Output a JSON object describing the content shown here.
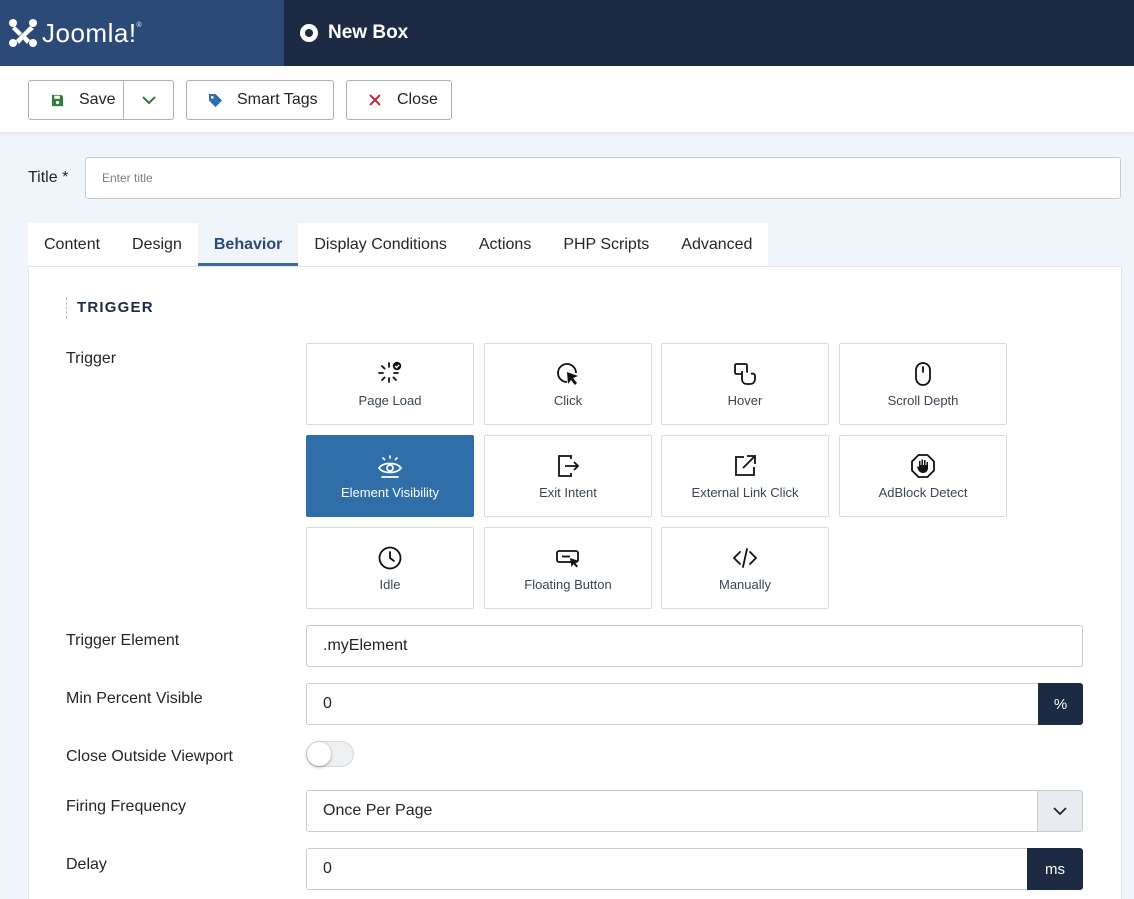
{
  "header": {
    "logo_text": "Joomla!",
    "page_title": "New Box"
  },
  "toolbar": {
    "save_label": "Save",
    "smart_tags_label": "Smart Tags",
    "close_label": "Close"
  },
  "form": {
    "title_label": "Title *",
    "title_placeholder": "Enter title",
    "title_value": ""
  },
  "tabs": [
    {
      "label": "Content",
      "active": false
    },
    {
      "label": "Design",
      "active": false
    },
    {
      "label": "Behavior",
      "active": true
    },
    {
      "label": "Display Conditions",
      "active": false
    },
    {
      "label": "Actions",
      "active": false
    },
    {
      "label": "PHP Scripts",
      "active": false
    },
    {
      "label": "Advanced",
      "active": false
    }
  ],
  "behavior": {
    "section_heading": "TRIGGER",
    "trigger_label": "Trigger",
    "triggers": [
      {
        "label": "Page Load",
        "icon": "page-load-icon",
        "selected": false
      },
      {
        "label": "Click",
        "icon": "click-icon",
        "selected": false
      },
      {
        "label": "Hover",
        "icon": "hover-icon",
        "selected": false
      },
      {
        "label": "Scroll Depth",
        "icon": "mouse-icon",
        "selected": false
      },
      {
        "label": "Element Visibility",
        "icon": "eye-icon",
        "selected": true
      },
      {
        "label": "Exit Intent",
        "icon": "exit-icon",
        "selected": false
      },
      {
        "label": "External Link Click",
        "icon": "external-link-icon",
        "selected": false
      },
      {
        "label": "AdBlock Detect",
        "icon": "adblock-icon",
        "selected": false
      },
      {
        "label": "Idle",
        "icon": "clock-icon",
        "selected": false
      },
      {
        "label": "Floating Button",
        "icon": "floating-button-icon",
        "selected": false
      },
      {
        "label": "Manually",
        "icon": "code-icon",
        "selected": false
      }
    ],
    "trigger_element_label": "Trigger Element",
    "trigger_element_value": ".myElement",
    "min_percent_label": "Min Percent Visible",
    "min_percent_value": "0",
    "min_percent_unit": "%",
    "close_outside_label": "Close Outside Viewport",
    "close_outside_on": false,
    "firing_label": "Firing Frequency",
    "firing_value": "Once Per Page",
    "delay_label": "Delay",
    "delay_value": "0",
    "delay_unit": "ms"
  },
  "colors": {
    "header_bg": "#1c2a44",
    "logo_bg": "#2c4a78",
    "accent": "#2f6ea8",
    "save_icon": "#2f7d3a",
    "close_icon": "#c5283d",
    "tag_icon": "#2f6ea8"
  }
}
